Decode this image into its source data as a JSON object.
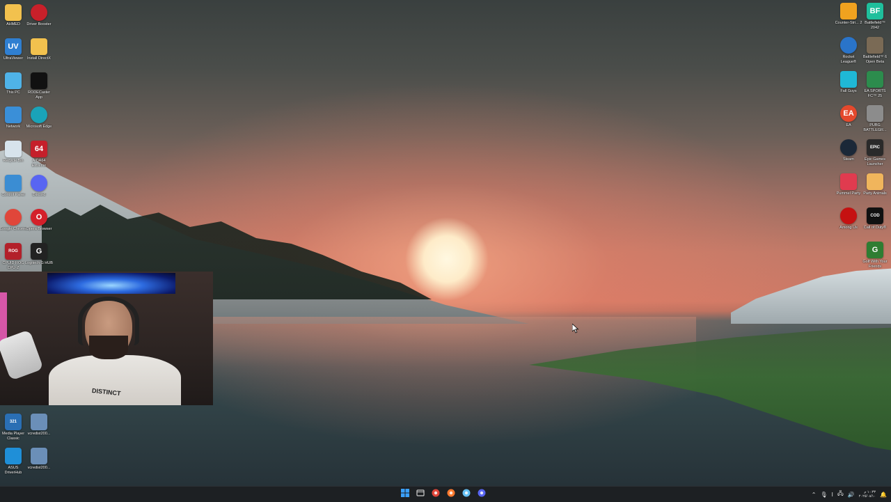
{
  "desktop": {
    "left_column_1": [
      {
        "label": "AHMED",
        "icon": "folder-icon",
        "color": "#f2c14e",
        "glyph": ""
      },
      {
        "label": "UltraViewer",
        "icon": "ultraviewer-icon",
        "color": "#2f7fd1",
        "glyph": "UV"
      },
      {
        "label": "This PC",
        "icon": "computer-icon",
        "color": "#4fb3e8",
        "glyph": ""
      },
      {
        "label": "Network",
        "icon": "network-icon",
        "color": "#3a8fd8",
        "glyph": ""
      },
      {
        "label": "Recycle Bin",
        "icon": "recycle-bin-icon",
        "color": "#d7e3ec",
        "glyph": ""
      },
      {
        "label": "Control Panel",
        "icon": "control-panel-icon",
        "color": "#3b8dd3",
        "glyph": ""
      },
      {
        "label": "Google Chrome",
        "icon": "chrome-icon",
        "color": "#e0463a",
        "glyph": ""
      },
      {
        "label": "CPUID ROG CPU-Z",
        "icon": "cpuz-icon",
        "color": "#b3202a",
        "glyph": "ROG"
      },
      {
        "label": "Media Player Classic",
        "icon": "media-player-icon",
        "color": "#2a6fb4",
        "glyph": "321"
      },
      {
        "label": "ASUS DriverHub",
        "icon": "asus-driverhub-icon",
        "color": "#1f8fd8",
        "glyph": ""
      }
    ],
    "left_column_2": [
      {
        "label": "Driver Booster",
        "icon": "driver-booster-icon",
        "color": "#c8202a",
        "glyph": ""
      },
      {
        "label": "Install DirectX",
        "icon": "folder-icon",
        "color": "#f2c14e",
        "glyph": ""
      },
      {
        "label": "RODECaster App",
        "icon": "rodecaster-icon",
        "color": "#111111",
        "glyph": ""
      },
      {
        "label": "Microsoft Edge",
        "icon": "edge-icon",
        "color": "#1aa3b8",
        "glyph": ""
      },
      {
        "label": "AIDA64 Extreme",
        "icon": "aida64-icon",
        "color": "#c5202b",
        "glyph": "64"
      },
      {
        "label": "Discord",
        "icon": "discord-icon",
        "color": "#5865f2",
        "glyph": ""
      },
      {
        "label": "Opera Browser",
        "icon": "opera-icon",
        "color": "#d4202a",
        "glyph": "O"
      },
      {
        "label": "Logitech G HUB",
        "icon": "logitech-ghub-icon",
        "color": "#222222",
        "glyph": "G"
      },
      {
        "label": "vcredist200...",
        "icon": "installer-icon",
        "color": "#6b8fb8",
        "glyph": ""
      },
      {
        "label": "vcredist200...",
        "icon": "installer-icon",
        "color": "#6b8fb8",
        "glyph": ""
      }
    ],
    "right_column_1": [
      {
        "label": "Counter-Stri... 2",
        "icon": "counter-strike-icon",
        "color": "#f0a21f",
        "glyph": ""
      },
      {
        "label": "Rocket League®",
        "icon": "rocket-league-icon",
        "color": "#2a74c9",
        "glyph": ""
      },
      {
        "label": "Fall Guys",
        "icon": "fall-guys-icon",
        "color": "#1fb8d6",
        "glyph": ""
      },
      {
        "label": "EA",
        "icon": "ea-icon",
        "color": "#e4492d",
        "glyph": "EA"
      },
      {
        "label": "Steam",
        "icon": "steam-icon",
        "color": "#1b2838",
        "glyph": ""
      },
      {
        "label": "Pummel Party",
        "icon": "pummel-party-icon",
        "color": "#e03b4f",
        "glyph": ""
      },
      {
        "label": "Among Us",
        "icon": "among-us-icon",
        "color": "#c51111",
        "glyph": ""
      }
    ],
    "right_column_2": [
      {
        "label": "Battlefield™ 2042",
        "icon": "battlefield-2042-icon",
        "color": "#1fbf9c",
        "glyph": "BF"
      },
      {
        "label": "Battlefield™ 6 Open Beta",
        "icon": "battlefield-6-icon",
        "color": "#7a6a55",
        "glyph": ""
      },
      {
        "label": "EA SPORTS FC™ 25",
        "icon": "ea-fc-icon",
        "color": "#2c8c4d",
        "glyph": ""
      },
      {
        "label": "PUBG BATTLEGR...",
        "icon": "pubg-icon",
        "color": "#8c8c8c",
        "glyph": ""
      },
      {
        "label": "Epic Games Launcher",
        "icon": "epic-games-icon",
        "color": "#2a2a2a",
        "glyph": "EPIC"
      },
      {
        "label": "Party Animals",
        "icon": "party-animals-icon",
        "color": "#f0b55c",
        "glyph": ""
      },
      {
        "label": "Call of Duty®",
        "icon": "call-of-duty-icon",
        "color": "#111111",
        "glyph": "COD"
      },
      {
        "label": "Golf With Your Friends",
        "icon": "golf-with-friends-icon",
        "color": "#2f7d32",
        "glyph": "G"
      }
    ]
  },
  "webcam": {
    "shirt_text": "DISTINCT"
  },
  "taskbar": {
    "apps": [
      {
        "name": "start-button",
        "icon": "windows-logo-icon",
        "color": "#3aa0ff"
      },
      {
        "name": "file-explorer-button",
        "icon": "file-explorer-icon",
        "color": "#cfcfcf"
      },
      {
        "name": "chrome-taskbar-button",
        "icon": "chrome-icon",
        "color": "#e0463a"
      },
      {
        "name": "firefox-taskbar-button",
        "icon": "firefox-icon",
        "color": "#ff7a2f"
      },
      {
        "name": "steam-taskbar-button",
        "icon": "steam-icon",
        "color": "#66c0f4"
      },
      {
        "name": "discord-taskbar-button",
        "icon": "discord-icon",
        "color": "#5865f2"
      }
    ],
    "tray": {
      "time": "١٠:٣٣ م",
      "date": "٢٠٢٥/٠٨/١٠"
    }
  }
}
